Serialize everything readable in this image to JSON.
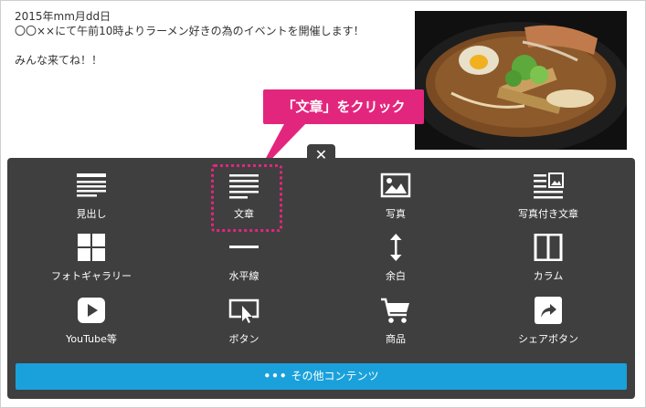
{
  "article": {
    "date": "2015年mm月dd日",
    "line1": "〇〇××にて午前10時よりラーメン好きの為のイベントを開催します！",
    "line2": "みんな来てね！！"
  },
  "callout": {
    "text": "「文章」をクリック",
    "color": "#e3267d"
  },
  "panel": {
    "close_icon": "close-icon",
    "items": [
      {
        "label": "見出し",
        "icon": "heading-icon"
      },
      {
        "label": "文章",
        "icon": "text-icon"
      },
      {
        "label": "写真",
        "icon": "image-icon"
      },
      {
        "label": "写真付き文章",
        "icon": "image-text-icon"
      },
      {
        "label": "フォトギャラリー",
        "icon": "gallery-icon"
      },
      {
        "label": "水平線",
        "icon": "horizontal-line-icon"
      },
      {
        "label": "余白",
        "icon": "spacing-icon"
      },
      {
        "label": "カラム",
        "icon": "column-icon"
      },
      {
        "label": "YouTube等",
        "icon": "youtube-icon"
      },
      {
        "label": "ボタン",
        "icon": "button-icon"
      },
      {
        "label": "商品",
        "icon": "cart-icon"
      },
      {
        "label": "シェアボタン",
        "icon": "share-icon"
      }
    ],
    "more_button": "その他コンテンツ"
  },
  "colors": {
    "panel_bg": "#3f3f3f",
    "accent_blue": "#1aa1db",
    "accent_pink": "#e3267d"
  }
}
